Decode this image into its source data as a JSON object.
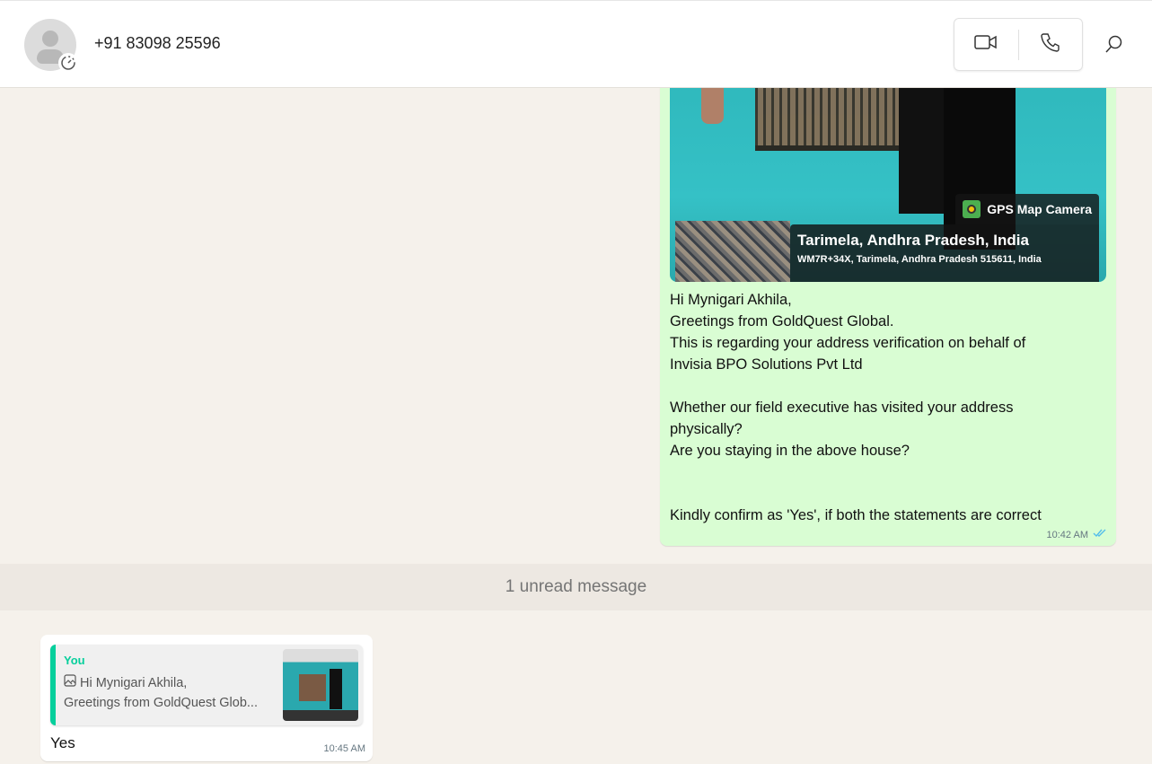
{
  "header": {
    "contact": "+91 83098 25596",
    "icons": [
      "avatar-icon",
      "disappearing-timer-icon",
      "video-call-icon",
      "voice-call-icon",
      "search-icon"
    ]
  },
  "outgoing": {
    "photo": {
      "watermark": "GPS Map Camera",
      "location": "Tarimela, Andhra Pradesh, India",
      "address": "WM7R+34X, Tarimela, Andhra Pradesh 515611, India"
    },
    "lines": [
      "Hi Mynigari Akhila,",
      "Greetings from GoldQuest Global.",
      "This is regarding your address verification on behalf of",
      "Invisia BPO Solutions Pvt Ltd",
      "",
      "Whether our field executive has visited your address",
      "physically?",
      "Are you staying in the above house?",
      "",
      "",
      "Kindly confirm as 'Yes', if both the statements are correct"
    ],
    "time": "10:42 AM",
    "status": "read",
    "tick_color": "#53bdeb"
  },
  "unread": "1 unread message",
  "incoming": {
    "quote": {
      "author": "You",
      "line1": "Hi Mynigari Akhila,",
      "line2": "Greetings from GoldQuest Glob..."
    },
    "text": "Yes",
    "time": "10:45 AM"
  },
  "colors": {
    "outgoing_bubble": "#d9fdd3",
    "quote_accent": "#06cf9c"
  }
}
